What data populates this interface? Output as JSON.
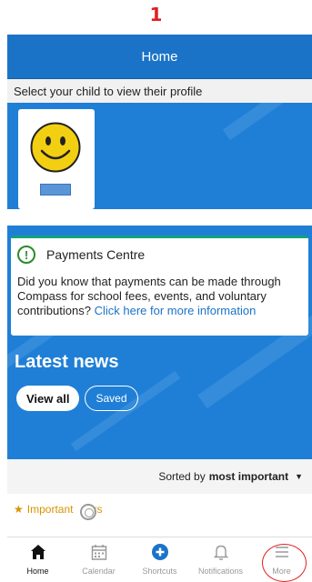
{
  "step": "1",
  "header": {
    "title": "Home"
  },
  "profile": {
    "select_text": "Select your child to view their profile"
  },
  "payments": {
    "title": "Payments Centre",
    "text": "Did you know that payments can be made through Compass for school fees, events, and voluntary contributions?",
    "link": "Click here for more information"
  },
  "news": {
    "title": "Latest news",
    "view_all": "View all",
    "saved": "Saved",
    "sorted_by": "Sorted by",
    "sort_value": "most important",
    "important_label": "Important",
    "important_suffix": "rs"
  },
  "tabbar": {
    "items": [
      {
        "label": "Home",
        "icon": "home-icon"
      },
      {
        "label": "Calendar",
        "icon": "calendar-icon"
      },
      {
        "label": "Shortcuts",
        "icon": "plus-circle-icon"
      },
      {
        "label": "Notifications",
        "icon": "bell-icon"
      },
      {
        "label": "More",
        "icon": "menu-icon"
      }
    ]
  },
  "colors": {
    "brand_blue": "#1b73c8",
    "accent_green": "#13a37a",
    "important_gold": "#d89400",
    "highlight_red": "#e02020"
  }
}
